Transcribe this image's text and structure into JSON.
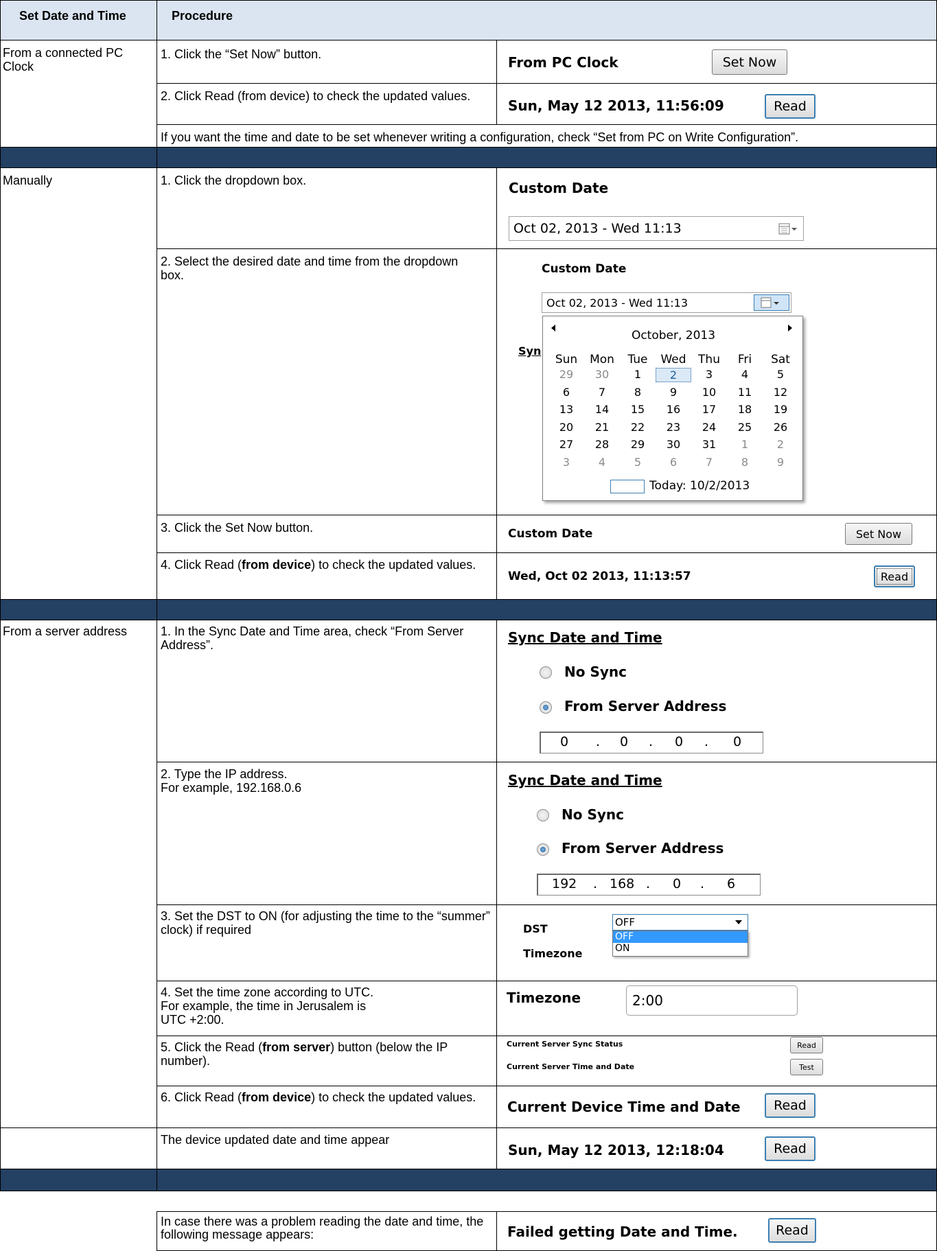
{
  "header": {
    "col1": "Set Date and Time",
    "col2": "Procedure"
  },
  "pc": {
    "method": "From a connected PC Clock",
    "step1": "1.  Click the “Set Now” button.",
    "step2": "2.  Click Read (from device) to check the updated values.",
    "note": "If you want the time and date to be set whenever writing a configuration, check “Set from PC on Write Configuration”.",
    "ui_label": "From PC Clock",
    "set_now": "Set Now",
    "datetime": "Sun, May 12 2013, 11:56:09",
    "read": "Read"
  },
  "manual": {
    "method": "Manually",
    "step1": "1.  Click the dropdown box.",
    "step2": "2.  Select the desired date and time from the dropdown box.",
    "step3": "3.  Click the Set Now button.",
    "step4_a": "4.  Click Read (",
    "step4_b": "from device",
    "step4_c": ") to check the updated values.",
    "custom_date": "Custom Date",
    "date_value": "Oct  02, 2013 - Wed 11:13",
    "sync_partial": "Syn",
    "calendar": {
      "month": "October, 2013",
      "weekdays": [
        "Sun",
        "Mon",
        "Tue",
        "Wed",
        "Thu",
        "Fri",
        "Sat"
      ],
      "rows": [
        [
          "29",
          "30",
          "1",
          "2",
          "3",
          "4",
          "5"
        ],
        [
          "6",
          "7",
          "8",
          "9",
          "10",
          "11",
          "12"
        ],
        [
          "13",
          "14",
          "15",
          "16",
          "17",
          "18",
          "19"
        ],
        [
          "20",
          "21",
          "22",
          "23",
          "24",
          "25",
          "26"
        ],
        [
          "27",
          "28",
          "29",
          "30",
          "31",
          "1",
          "2"
        ],
        [
          "3",
          "4",
          "5",
          "6",
          "7",
          "8",
          "9"
        ]
      ],
      "today": "Today: 10/2/2013"
    },
    "set_now": "Set Now",
    "datetime": "Wed, Oct 02 2013,  11:13:57",
    "read": "Read"
  },
  "server": {
    "method": "From a server address",
    "step1": "1.  In the Sync Date and Time area, check “From Server Address”.",
    "step2_l1": "2.  Type the IP address.",
    "step2_l2": "For example, 192.168.0.6",
    "step3": "3.  Set the DST to ON (for adjusting the time to the “summer” clock) if required",
    "step4_l1": "4.  Set the time zone according to UTC.",
    "step4_l2": "For example, the time in Jerusalem is",
    "step4_l3": "UTC +2:00.",
    "step5_a": "5.  Click the Read (",
    "step5_b": "from server",
    "step5_c": ") button (below the IP number).",
    "step6_a": "6.  Click Read (",
    "step6_b": "from device",
    "step6_c": ") to check the updated values.",
    "result": "The device updated date and time appear",
    "sync_title": "Sync Date and Time",
    "no_sync": "No Sync",
    "from_server": "From Server Address",
    "ip_empty": [
      "0",
      "0",
      "0",
      "0"
    ],
    "ip_example": [
      "192",
      "168",
      "0",
      "6"
    ],
    "dst_label": "DST",
    "dst_value": "OFF",
    "dst_options": [
      "OFF",
      "ON"
    ],
    "timezone_label": "Timezone",
    "timezone_value": "2:00",
    "sync_status": "Current Server Sync Status",
    "server_time": "Current Server Time and Date",
    "read": "Read",
    "test": "Test",
    "device_label": "Current Device Time and Date",
    "device_datetime": "Sun, May 12 2013, 12:18:04"
  },
  "failure": {
    "text": "In case there was a problem reading the date and time, the following message appears:",
    "message": "Failed getting Date and Time.",
    "read": "Read"
  }
}
